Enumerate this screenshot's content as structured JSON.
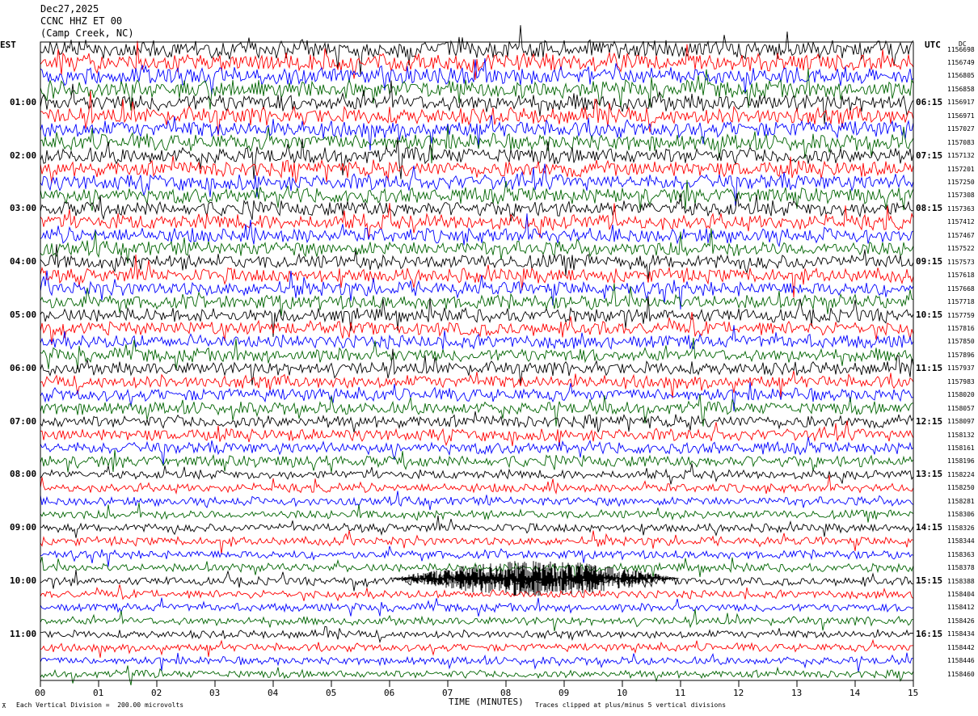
{
  "header": {
    "date": "Dec27,2025",
    "station": "CCNC HHZ ET 00",
    "location": "(Camp Creek, NC)"
  },
  "left_axis_title": "EST",
  "right_axis_title": "UTC",
  "dc_header": "DC",
  "footer": {
    "scale_text": "Each Vertical Division =  200.00 microvolts",
    "x_title": "TIME (MINUTES)",
    "clip_text": "Traces clipped at plus/minus 5 vertical divisions"
  },
  "chart_data": {
    "type": "helicorder",
    "xlabel": "TIME (MINUTES)",
    "xlim": [
      0,
      15
    ],
    "x_ticks": [
      "00",
      "01",
      "02",
      "03",
      "04",
      "05",
      "06",
      "07",
      "08",
      "09",
      "10",
      "11",
      "12",
      "13",
      "14",
      "15"
    ],
    "trace_colors": [
      "#000000",
      "#ff0000",
      "#0000ff",
      "#006400"
    ],
    "rows_per_hour": 4,
    "row_count": 48,
    "left_labels": [
      "01:00",
      "02:00",
      "03:00",
      "04:00",
      "05:00",
      "06:00",
      "07:00",
      "08:00",
      "09:00",
      "10:00",
      "11:00"
    ],
    "right_labels": [
      "06:15",
      "07:15",
      "08:15",
      "09:15",
      "10:15",
      "11:15",
      "12:15",
      "13:15",
      "14:15",
      "15:15",
      "16:15"
    ],
    "dc_offsets": [
      "1156698",
      "1156749",
      "1156805",
      "1156858",
      "1156917",
      "1156971",
      "1157027",
      "1157083",
      "1157132",
      "1157201",
      "1157250",
      "1157308",
      "1157363",
      "1157412",
      "1157467",
      "1157522",
      "1157573",
      "1157618",
      "1157668",
      "1157718",
      "1157759",
      "1157816",
      "1157850",
      "1157896",
      "1157937",
      "1157983",
      "1158020",
      "1158057",
      "1158097",
      "1158132",
      "1158161",
      "1158196",
      "1158224",
      "1158250",
      "1158281",
      "1158306",
      "1158326",
      "1158344",
      "1158363",
      "1158378",
      "1158388",
      "1158404",
      "1158412",
      "1158426",
      "1158434",
      "1158442",
      "1158446",
      "1158460"
    ],
    "event": {
      "label": "seismic burst",
      "row_start": 38,
      "row_end": 42,
      "minute_start": 6.0,
      "minute_end": 11.0
    },
    "scale_microvolts_per_division": 200.0,
    "clip_divisions": 5
  }
}
